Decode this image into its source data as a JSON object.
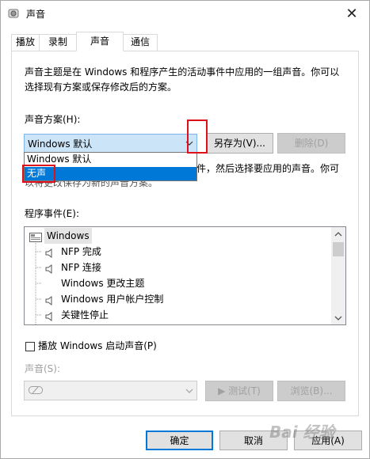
{
  "window": {
    "title": "声音",
    "close_glyph": "✕"
  },
  "tabs": [
    {
      "label": "播放"
    },
    {
      "label": "录制"
    },
    {
      "label": "声音"
    },
    {
      "label": "通信"
    }
  ],
  "sound_tab": {
    "intro": [
      "声音主题是在 Windows 和程序产生的活动事件中应用的一组声音。你可以",
      "选择现有方案或保存修改后的方案。"
    ],
    "scheme_label": "声音方案(H):",
    "scheme_value": "Windows 默认",
    "save_as_label": "另存为(V)...",
    "delete_label": "删除(D)",
    "dropdown_options": [
      "Windows 默认",
      "无声"
    ],
    "partially_hidden_text_1": "件，然后选择要应用的声音。你可",
    "partially_hidden_text_2": "以将更改保存为新的声音方案。",
    "events_label": "程序事件(E):",
    "events": [
      {
        "label": "Windows",
        "icon": "windows-folder-icon",
        "selected": true
      },
      {
        "label": "NFP 完成",
        "icon": "speaker-icon"
      },
      {
        "label": "NFP 连接",
        "icon": "speaker-icon"
      },
      {
        "label": "Windows 更改主题",
        "icon": ""
      },
      {
        "label": "Windows 用户帐户控制",
        "icon": "speaker-icon"
      },
      {
        "label": "关键性停止",
        "icon": "speaker-icon"
      }
    ],
    "startup_checkbox_label": "播放 Windows 启动声音(P)",
    "startup_checked": false,
    "sound_label": "声音(S):",
    "test_label": "▶ 测试(T)",
    "browse_label": "浏览(B)..."
  },
  "footer": {
    "ok_label": "确定",
    "cancel_label": "取消",
    "apply_label": "应用(A)"
  },
  "watermark": "Bai 经验"
}
